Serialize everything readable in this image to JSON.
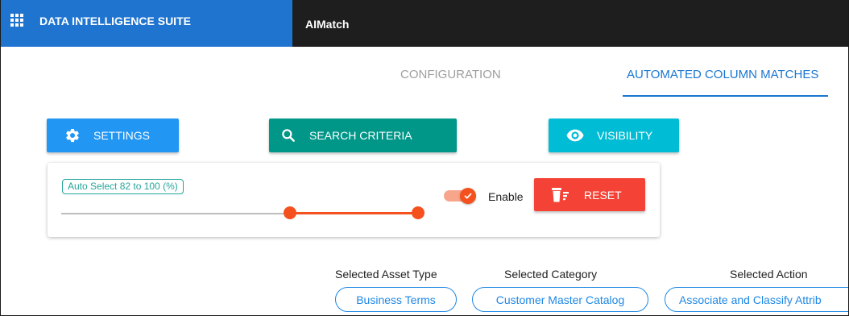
{
  "header": {
    "suite_title": "DATA INTELLIGENCE SUITE",
    "app_name": "AIMatch",
    "apps_icon": "grid-apps-icon",
    "brand_color": "#1f74cf"
  },
  "tabs": [
    {
      "label": "CONFIGURATION",
      "active": false
    },
    {
      "label": "AUTOMATED COLUMN MATCHES",
      "active": true
    }
  ],
  "actions": {
    "settings_label": "SETTINGS",
    "settings_icon": "gear-icon",
    "search_label": "SEARCH CRITERIA",
    "search_icon": "search-icon",
    "visibility_label": "VISIBILITY",
    "visibility_icon": "eye-icon"
  },
  "auto_select": {
    "label": "Auto Select 82 to 100 (%)",
    "range_min": 82,
    "range_max": 100,
    "enabled": true,
    "enable_label": "Enable",
    "reset_label": "RESET",
    "reset_icon": "trash-sweep-icon"
  },
  "selection": {
    "asset_type_label": "Selected Asset Type",
    "asset_type_value": "Business Terms",
    "category_label": "Selected Category",
    "category_value": "Customer Master Catalog",
    "action_label": "Selected Action",
    "action_value": "Associate and Classify Attrib"
  },
  "colors": {
    "settings": "#2196f3",
    "search": "#009688",
    "visibility": "#00bcd4",
    "reset": "#f44336",
    "slider": "#f4511e",
    "tab_active": "#1976d2"
  }
}
